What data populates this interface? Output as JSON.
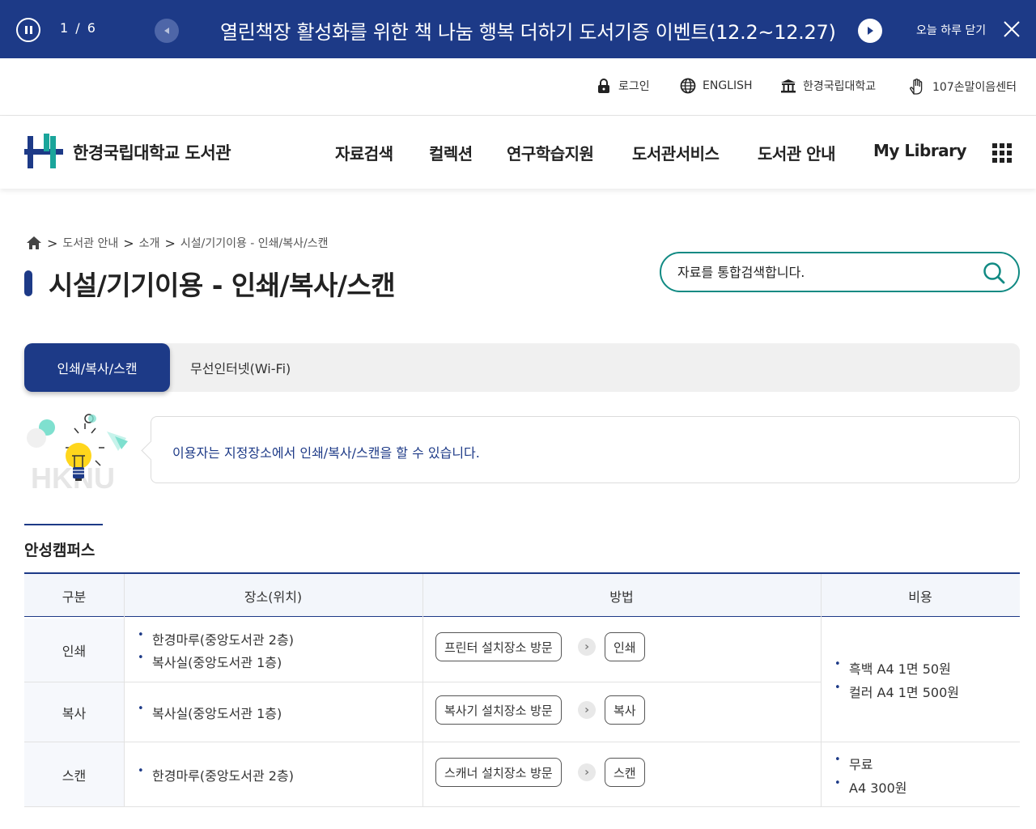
{
  "banner": {
    "counter": "1 / 6",
    "title": "열린책장 활성화를 위한 책 나눔 행복 더하기 도서기증 이벤트(12.2~12.27)",
    "close_today": "오늘 하루 닫기"
  },
  "util": {
    "login": "로그인",
    "english": "ENGLISH",
    "university": "한경국립대학교",
    "sign_center": "107손말이음센터"
  },
  "header": {
    "logo_text": "한경국립대학교 도서관",
    "nav": [
      "자료검색",
      "컬렉션",
      "연구학습지원",
      "도서관서비스",
      "도서관 안내",
      "My Library"
    ]
  },
  "breadcrumb": [
    "도서관 안내",
    "소개",
    "시설/기기이용 - 인쇄/복사/스캔"
  ],
  "page_title": "시설/기기이용 - 인쇄/복사/스캔",
  "search": {
    "placeholder": "자료를 통합검색합니다."
  },
  "tabs": [
    "인쇄/복사/스캔",
    "무선인터넷(Wi-Fi)"
  ],
  "info": {
    "illust_text": "HKNU",
    "text": "이용자는 지정장소에서 인쇄/복사/스캔을 할 수 있습니다."
  },
  "section": {
    "title": "안성캠퍼스"
  },
  "table": {
    "headers": [
      "구분",
      "장소(위치)",
      "방법",
      "비용"
    ],
    "rows": [
      {
        "type": "인쇄",
        "places": [
          "한경마루(중앙도서관 2층)",
          "복사실(중앙도서관 1층)"
        ],
        "step1": "프린터 설치장소 방문",
        "step2": "인쇄"
      },
      {
        "type": "복사",
        "places": [
          "복사실(중앙도서관 1층)"
        ],
        "step1": "복사기 설치장소 방문",
        "step2": "복사"
      },
      {
        "type": "스캔",
        "places": [
          "한경마루(중앙도서관 2층)"
        ],
        "step1": "스캐너 설치장소 방문",
        "step2": "스캔"
      }
    ],
    "cost_print_copy": [
      "흑백 A4 1면 50원",
      "컬러 A4 1면 500원"
    ],
    "cost_scan": [
      "무료",
      "A4 300원"
    ]
  },
  "colors": {
    "primary": "#1d3a87",
    "accent": "#118a83"
  }
}
